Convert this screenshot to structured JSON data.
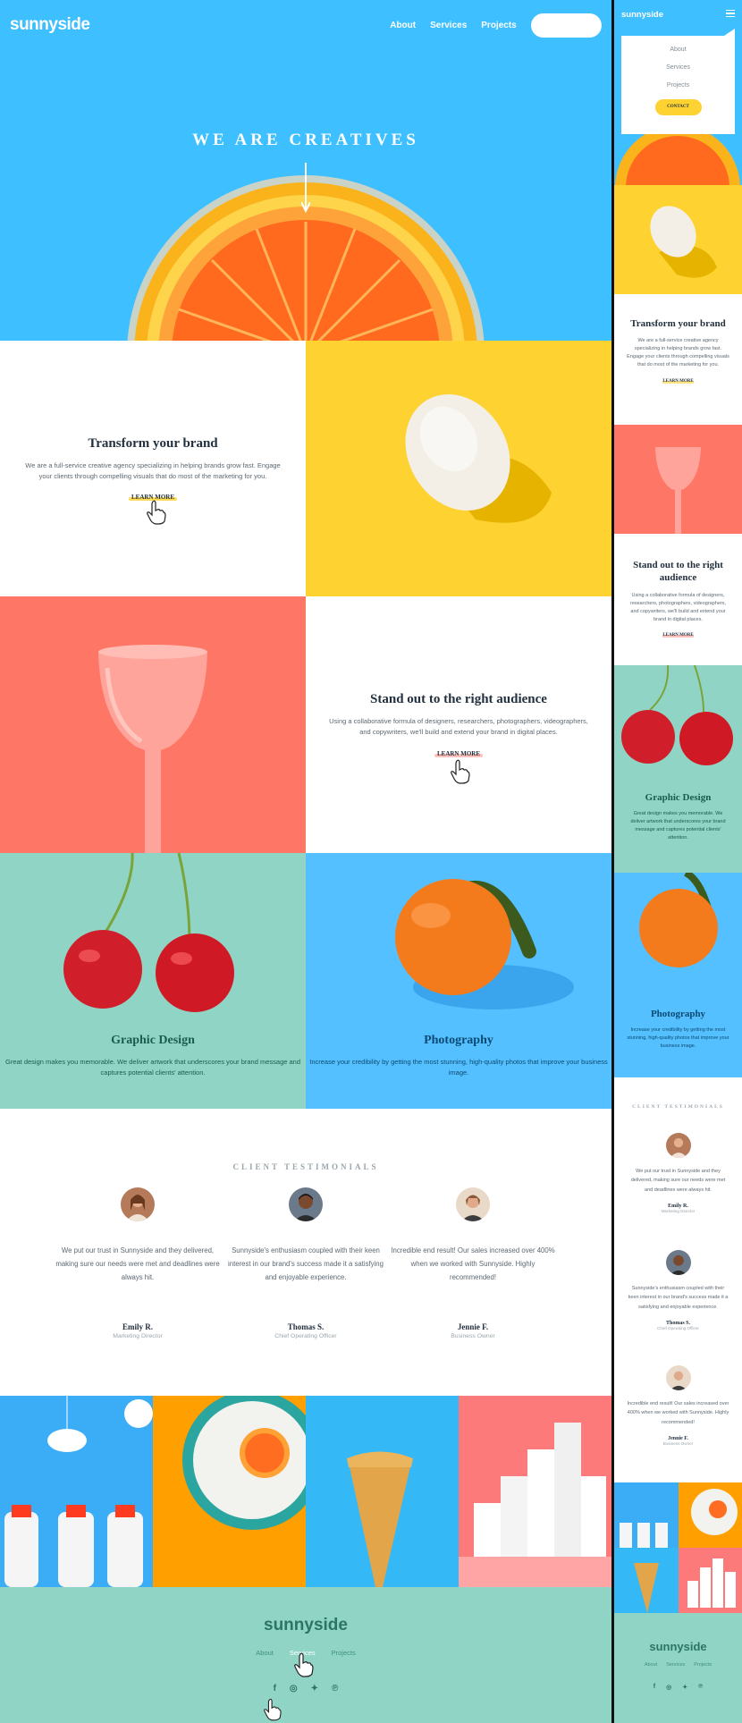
{
  "brand": "sunnyside",
  "nav": {
    "links": [
      "About",
      "Services",
      "Projects"
    ],
    "contact": "CONTACT"
  },
  "hero": {
    "title": "WE ARE CREATIVES"
  },
  "features": {
    "transform": {
      "title": "Transform your brand",
      "text": "We are a full-service creative agency specializing in helping brands grow fast. Engage your clients through compelling visuals that do most of the marketing for you.",
      "link": "LEARN MORE"
    },
    "standout": {
      "title": "Stand out to the right audience",
      "text": "Using a collaborative formula of designers, researchers, photographers, videographers, and copywriters, we'll build and extend your brand in digital places.",
      "link": "LEARN MORE"
    },
    "graphic": {
      "title": "Graphic Design",
      "text": "Great design makes you memorable. We deliver artwork that underscores your brand message and captures potential clients' attention."
    },
    "photo": {
      "title": "Photography",
      "text": "Increase your credibility by getting the most stunning, high-quality photos that improve your business image."
    }
  },
  "testimonials": {
    "label": "CLIENT TESTIMONIALS",
    "items": [
      {
        "quote": "We put our trust in Sunnyside and they delivered, making sure our needs were met and deadlines were always hit.",
        "name": "Emily R.",
        "role": "Marketing Director"
      },
      {
        "quote": "Sunnyside's enthusiasm coupled with their keen interest in our brand's success made it a satisfying and enjoyable experience.",
        "name": "Thomas S.",
        "role": "Chief Operating Officer"
      },
      {
        "quote": "Incredible end result! Our sales increased over 400% when we worked with Sunnyside. Highly recommended!",
        "name": "Jennie F.",
        "role": "Business Owner"
      }
    ]
  },
  "footer": {
    "logo": "sunnyside",
    "links": [
      "About",
      "Services",
      "Projects"
    ],
    "social": [
      "facebook-icon",
      "instagram-icon",
      "twitter-icon",
      "pinterest-icon"
    ]
  },
  "colors": {
    "sky": "#3ebfff",
    "yellow": "#fdd231",
    "coral": "#fe7766",
    "teal": "#90d4c5",
    "dark": "#23303e"
  }
}
